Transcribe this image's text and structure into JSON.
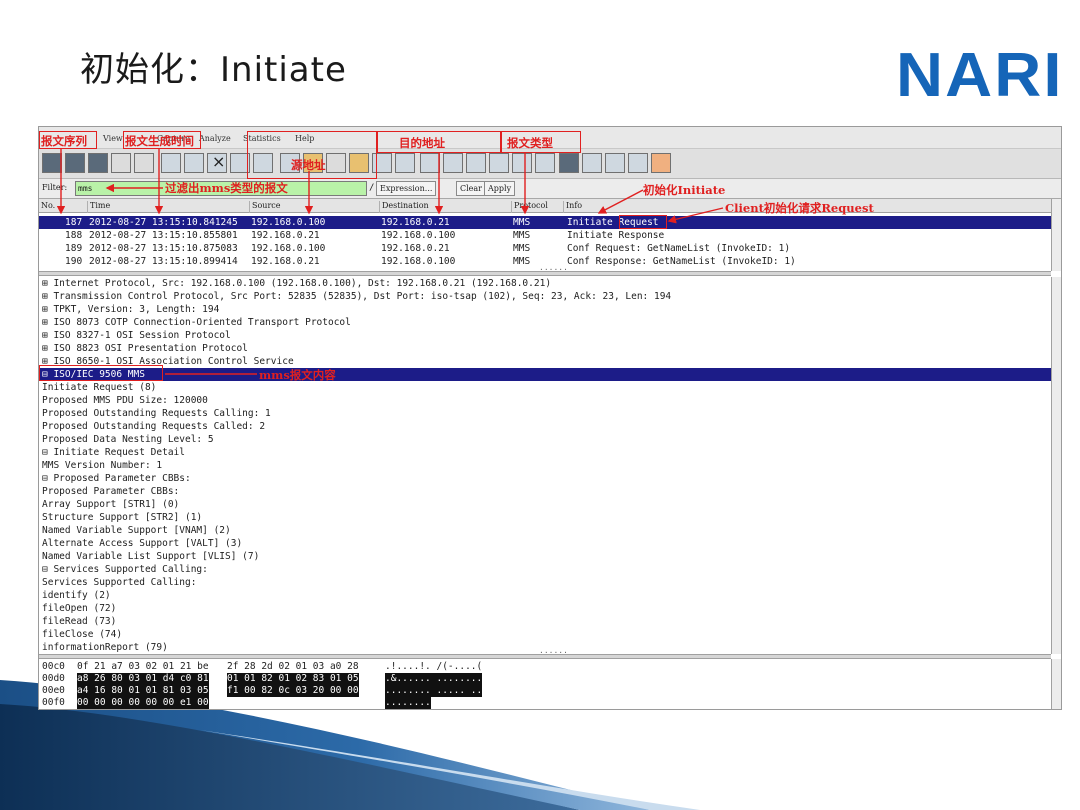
{
  "slide": {
    "title": "初始化：Initiate",
    "logo": "NARI"
  },
  "menu": [
    "View",
    "Capture",
    "Analyze",
    "Statistics",
    "Help"
  ],
  "filter": {
    "label": "Filter:",
    "value": "mms",
    "expression_label": "Expression...",
    "clear_label": "Clear",
    "apply_label": "Apply"
  },
  "columns": [
    "No. .",
    "Time",
    "Source",
    "Destination",
    "Protocol",
    "Info"
  ],
  "packets": [
    {
      "no": "187",
      "time": "2012-08-27 13:15:10.841245",
      "src": "192.168.0.100",
      "dst": "192.168.0.21",
      "proto": "MMS",
      "info": "Initiate Request"
    },
    {
      "no": "188",
      "time": "2012-08-27 13:15:10.855801",
      "src": "192.168.0.21",
      "dst": "192.168.0.100",
      "proto": "MMS",
      "info": "Initiate Response"
    },
    {
      "no": "189",
      "time": "2012-08-27 13:15:10.875083",
      "src": "192.168.0.100",
      "dst": "192.168.0.21",
      "proto": "MMS",
      "info": "Conf Request: GetNameList (InvokeID: 1)"
    },
    {
      "no": "190",
      "time": "2012-08-27 13:15:10.899414",
      "src": "192.168.0.21",
      "dst": "192.168.0.100",
      "proto": "MMS",
      "info": "Conf Response: GetNameList (InvokeID: 1)"
    }
  ],
  "details": [
    "⊞ Internet Protocol, Src: 192.168.0.100 (192.168.0.100), Dst: 192.168.0.21 (192.168.0.21)",
    "⊞ Transmission Control Protocol, Src Port: 52835 (52835), Dst Port: iso-tsap (102), Seq: 23, Ack: 23, Len: 194",
    "⊞ TPKT, Version: 3, Length: 194",
    "⊞ ISO 8073 COTP Connection-Oriented Transport Protocol",
    "⊞ ISO 8327-1 OSI Session Protocol",
    "⊞ ISO 8823 OSI Presentation Protocol",
    "⊞ ISO 8650-1 OSI Association Control Service",
    "⊟ ISO/IEC 9506 MMS",
    "    Initiate Request (8)",
    "    Proposed MMS PDU Size:  120000",
    "    Proposed Outstanding Requests Calling:   1",
    "    Proposed Outstanding Requests Called:   2",
    "    Proposed Data Nesting Level:  5",
    "  ⊟ Initiate Request Detail",
    "      MMS Version Number: 1",
    "    ⊟  Proposed Parameter CBBs:",
    "          Proposed Parameter CBBs:",
    "          Array Support [STR1] (0)",
    "          Structure Support [STR2] (1)",
    "          Named Variable Support [VNAM] (2)",
    "          Alternate Access Support [VALT] (3)",
    "          Named Variable List Support [VLIS] (7)",
    "    ⊟  Services Supported Calling:",
    "          Services Supported Calling:",
    "          identify (2)",
    "          fileOpen (72)",
    "          fileRead (73)",
    "          fileClose (74)",
    "          informationReport (79)"
  ],
  "hex": [
    {
      "offset": "00c0",
      "bytes_a": "0f 21 a7 03 02 01 21 be",
      "bytes_b": "2f 28 2d 02 01 03 a0 28",
      "ascii": ".!....!. /(-....(",
      "sel": false
    },
    {
      "offset": "00d0",
      "bytes_a": "a8 26 80 03 01 d4 c0 81",
      "bytes_b": "01 01 82 01 02 83 01 05",
      "ascii": ".&...... ........",
      "sel": true
    },
    {
      "offset": "00e0",
      "bytes_a": "a4 16 80 01 01 81 03 05",
      "bytes_b": "f1 00 82 0c 03 20 00 00",
      "ascii": "........ ..... ..",
      "sel": true
    },
    {
      "offset": "00f0",
      "bytes_a": "00 00 00 00 00 00 e1 00",
      "bytes_b": "",
      "ascii": "........",
      "sel": true
    }
  ],
  "annotations": {
    "seq": "报文序列",
    "time": "报文生成时间",
    "src": "源地址",
    "dst": "目的地址",
    "type": "报文类型",
    "filter": "过滤出mms类型的报文",
    "initiate": "初始化Initiate",
    "client_req": "Client初始化请求Request",
    "mms_content": "mms报文内容"
  },
  "colors": {
    "annotation": "#e02020",
    "selection": "#1c1c88",
    "filter_ok": "#b9f2a8",
    "logo": "#1565b8"
  }
}
